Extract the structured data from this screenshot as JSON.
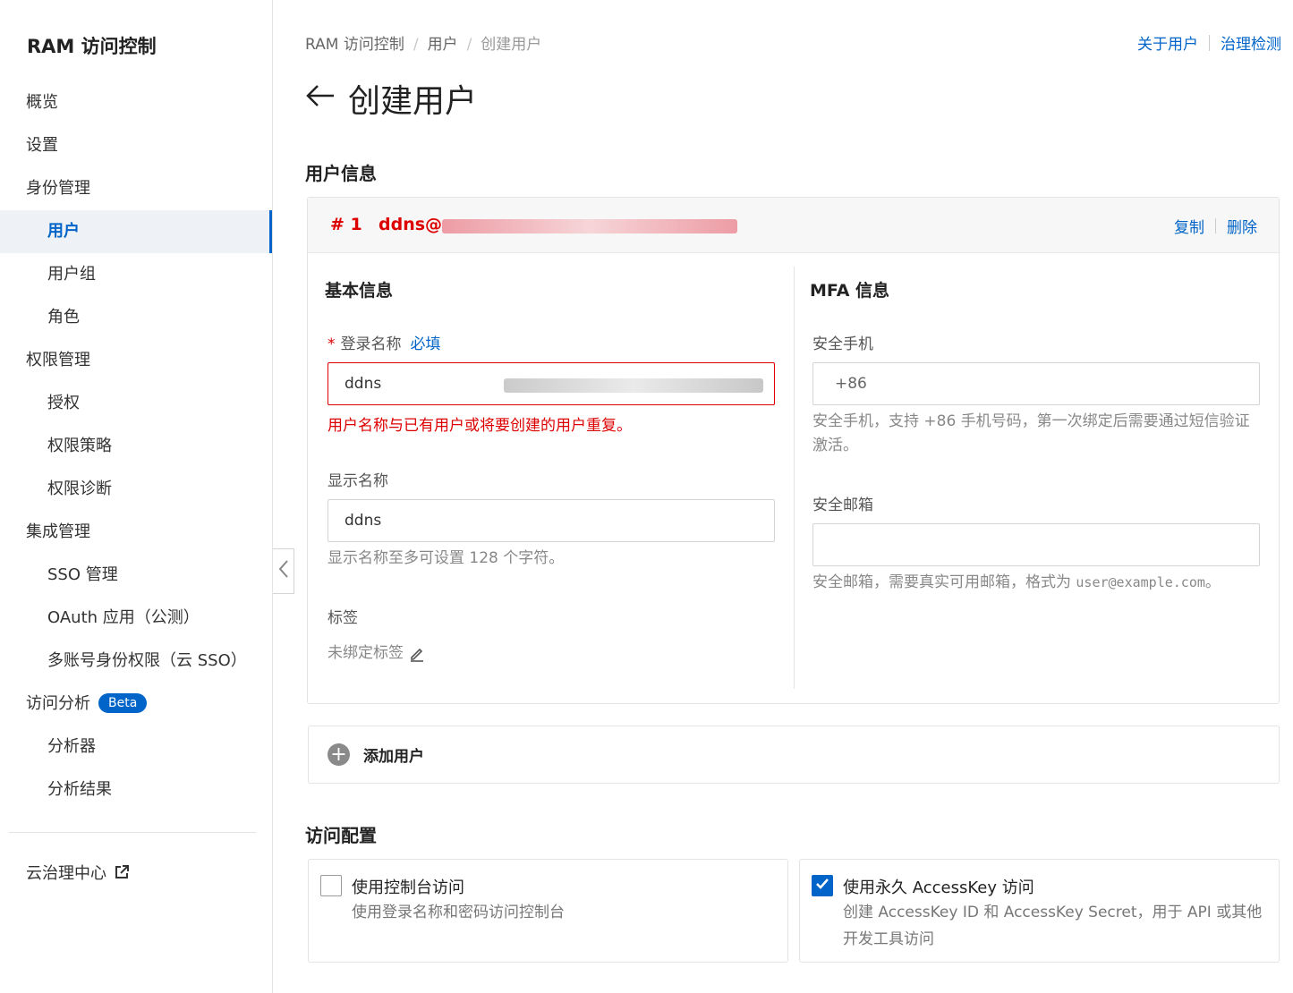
{
  "sidebar": {
    "title": "RAM 访问控制",
    "items": [
      {
        "label": "概览"
      },
      {
        "label": "设置"
      },
      {
        "label": "身份管理"
      },
      {
        "label": "用户"
      },
      {
        "label": "用户组"
      },
      {
        "label": "角色"
      },
      {
        "label": "权限管理"
      },
      {
        "label": "授权"
      },
      {
        "label": "权限策略"
      },
      {
        "label": "权限诊断"
      },
      {
        "label": "集成管理"
      },
      {
        "label": "SSO 管理"
      },
      {
        "label": "OAuth 应用（公测）"
      },
      {
        "label": "多账号身份权限（云 SSO）"
      },
      {
        "label": "访问分析",
        "badge": "Beta"
      },
      {
        "label": "分析器"
      },
      {
        "label": "分析结果"
      }
    ],
    "footer_link": "云治理中心"
  },
  "breadcrumb": [
    "RAM 访问控制",
    "用户",
    "创建用户"
  ],
  "top_links": {
    "about": "关于用户",
    "check": "治理检测"
  },
  "page": {
    "title": "创建用户",
    "back_icon": "arrow-left-icon"
  },
  "user_info": {
    "section_title": "用户信息",
    "card": {
      "index": "# 1",
      "username_prefix": "ddns@",
      "actions": {
        "copy": "复制",
        "delete": "删除"
      }
    },
    "basic": {
      "title": "基本信息",
      "login_name": {
        "required_mark": "*",
        "label": "登录名称",
        "hint": "必填",
        "value": "ddns",
        "error": "用户名称与已有用户或将要创建的用户重复。"
      },
      "display_name": {
        "label": "显示名称",
        "value": "ddns",
        "help": "显示名称至多可设置 128 个字符。"
      },
      "tags": {
        "label": "标签",
        "value": "未绑定标签"
      }
    },
    "mfa": {
      "title": "MFA 信息",
      "phone": {
        "label": "安全手机",
        "placeholder": "+86",
        "help": "安全手机，支持 +86 手机号码，第一次绑定后需要通过短信验证激活。"
      },
      "email": {
        "label": "安全邮箱",
        "value": "",
        "help_prefix": "安全邮箱，需要真实可用邮箱，格式为 ",
        "help_example": "user@example.com",
        "help_suffix": "。"
      }
    }
  },
  "add_user": {
    "label": "添加用户"
  },
  "access_config": {
    "section_title": "访问配置",
    "console": {
      "checked": false,
      "title": "使用控制台访问",
      "desc": "使用登录名称和密码访问控制台"
    },
    "accesskey": {
      "checked": true,
      "title": "使用永久 AccessKey 访问",
      "desc_line1": "创建 AccessKey ID 和 AccessKey Secret，用于 API 或其他",
      "desc_line2": "开发工具访问"
    }
  },
  "colors": {
    "accent": "#0064c8",
    "error": "#dd0000",
    "active_bg": "#eef1f5"
  }
}
